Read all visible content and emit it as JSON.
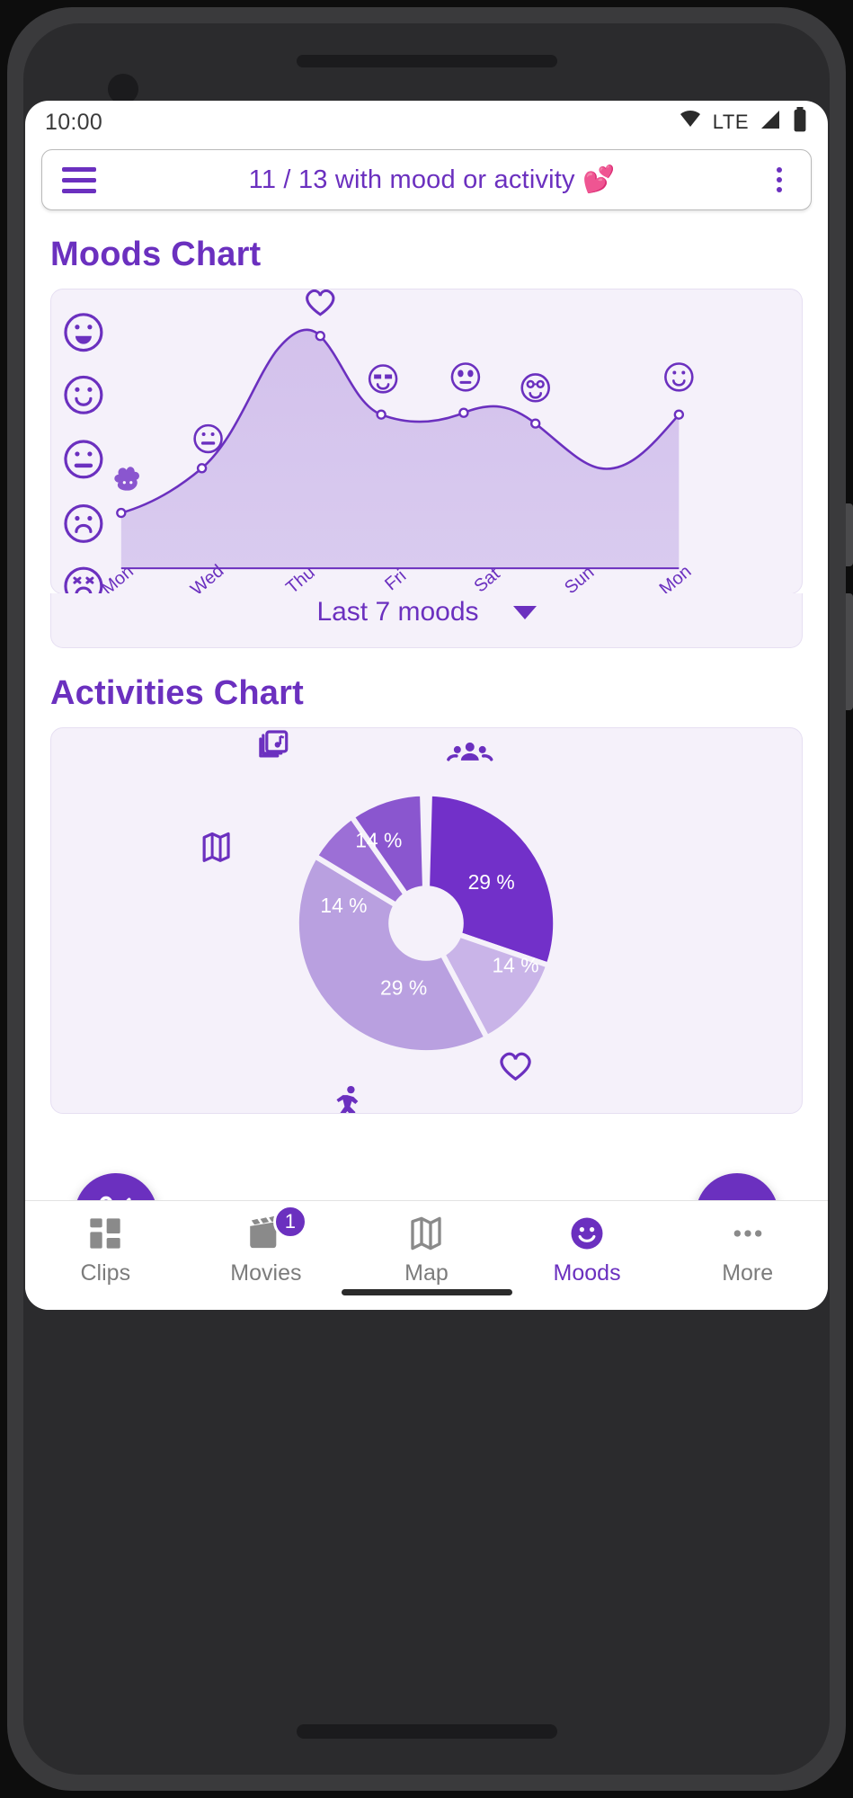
{
  "status_bar": {
    "time": "10:00",
    "network_label": "LTE",
    "icons": [
      "wifi-icon",
      "signal-icon",
      "battery-icon"
    ]
  },
  "app_bar": {
    "menu_icon": "hamburger-menu-icon",
    "title": "11 / 13 with mood or activity 💕",
    "overflow_icon": "kebab-menu-icon"
  },
  "moods_section": {
    "title": "Moods Chart",
    "dropdown": {
      "value": "Last 7 moods",
      "caret_icon": "chevron-down-icon"
    }
  },
  "activities_section": {
    "title": "Activities Chart"
  },
  "fabs": [
    {
      "name": "cut-fab",
      "icon": "scissors-icon"
    },
    {
      "name": "record-fab",
      "icon": "video-camera-icon"
    }
  ],
  "bottom_nav": {
    "items": [
      {
        "label": "Clips",
        "icon": "grid-dashboard-icon",
        "active": false,
        "badge": null
      },
      {
        "label": "Movies",
        "icon": "movie-clapper-icon",
        "active": false,
        "badge": "1"
      },
      {
        "label": "Map",
        "icon": "map-icon",
        "active": false,
        "badge": null
      },
      {
        "label": "Moods",
        "icon": "smiley-face-icon",
        "active": true,
        "badge": null
      },
      {
        "label": "More",
        "icon": "more-dots-icon",
        "active": false,
        "badge": null
      }
    ]
  },
  "colors": {
    "primary": "#6b30bf",
    "card_bg": "#f5f1fa",
    "area_fill": "#d8c8ee",
    "pink": "#f8628f",
    "inactive": "#7c7c7c"
  },
  "chart_data": [
    {
      "type": "line",
      "title": "Moods Chart",
      "xlabel": "",
      "ylabel": "",
      "x": [
        "Mon",
        "Wed",
        "Thu",
        "Fri",
        "Sat",
        "Sun",
        "Mon"
      ],
      "categories": [
        "Mon",
        "Wed",
        "Thu",
        "Fri",
        "Sat",
        "Sun",
        "Mon"
      ],
      "y_tick_labels": [
        "very-happy",
        "happy",
        "neutral",
        "sad",
        "very-sad"
      ],
      "ylim": [
        1,
        5
      ],
      "values": [
        2,
        3,
        5,
        4,
        4.1,
        3.4,
        4.3
      ],
      "series": [
        {
          "name": "mood",
          "values": [
            2,
            3,
            5,
            4,
            4.1,
            3.4,
            4.3
          ]
        }
      ],
      "point_markers": [
        {
          "x": "Mon",
          "y": 2,
          "emoji_label": "poop",
          "emoji": "💩"
        },
        {
          "x": "Wed",
          "y": 3,
          "emoji_label": "neutral",
          "emoji": "😐"
        },
        {
          "x": "Thu",
          "y": 5,
          "emoji_label": "heart",
          "emoji": "♡"
        },
        {
          "x": "Fri",
          "y": 4,
          "emoji_label": "sunglasses",
          "emoji": "😎"
        },
        {
          "x": "Sat",
          "y": 4.1,
          "emoji_label": "alien",
          "emoji": "👽"
        },
        {
          "x": "Sun",
          "y": 3.4,
          "emoji_label": "nerd",
          "emoji": "🤓"
        },
        {
          "x": "Mon",
          "y": 4.3,
          "emoji_label": "smile",
          "emoji": "🙂"
        }
      ],
      "grid": false,
      "legend": "none",
      "area_filled": true
    },
    {
      "type": "pie",
      "title": "Activities Chart",
      "donut": true,
      "labels": [
        "people",
        "heart",
        "running",
        "map",
        "music"
      ],
      "icons": [
        "people-group-icon",
        "heart-icon",
        "running-person-icon",
        "map-icon",
        "music-photo-icon"
      ],
      "values": [
        29,
        14,
        29,
        14,
        14
      ],
      "value_labels": [
        "29 %",
        "14 %",
        "29 %",
        "14 %",
        "14 %"
      ],
      "slice_colors": [
        "#7230c9",
        "#c9b4e8",
        "#b9a0e0",
        "#9c6fd6",
        "#8a56cf"
      ],
      "legend": "icons-around"
    }
  ]
}
